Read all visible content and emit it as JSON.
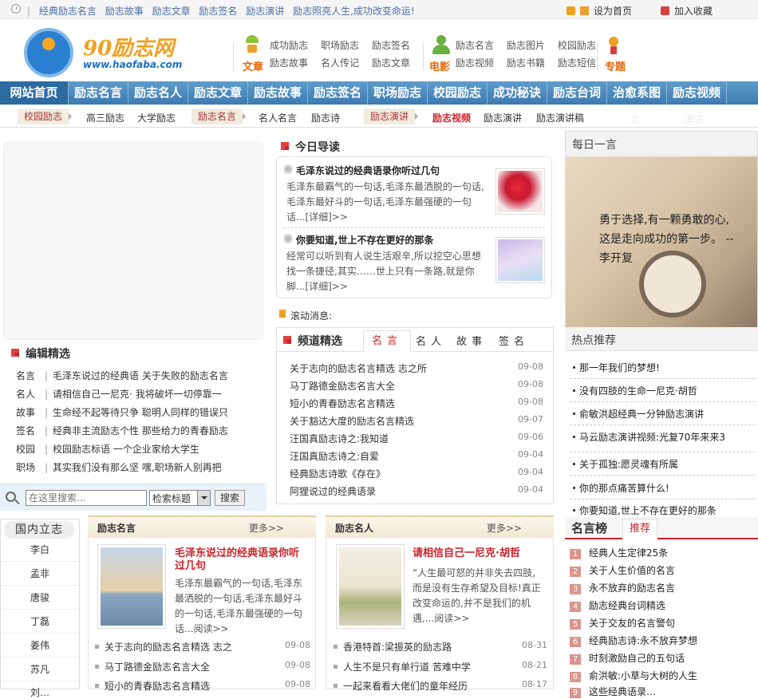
{
  "topbar": {
    "links": [
      "经典励志名言",
      "励志故事",
      "励志文章",
      "励志签名",
      "励志演讲",
      "励志照亮人生,成功改变命运!"
    ],
    "homepage": "设为首页",
    "favorite": "加入收藏"
  },
  "logo": {
    "name": "90励志网",
    "url": "www.haofaba.com"
  },
  "header_nav": {
    "group1_label": "文章",
    "group1": [
      "成功励志",
      "职场励志",
      "励志签名",
      "励志故事",
      "名人传记",
      "励志文章"
    ],
    "group2_label": "电影",
    "group2": [
      "励志名言",
      "励志图片",
      "校园励志",
      "励志视频",
      "励志书籍",
      "励志短信"
    ],
    "group3_label": "专题"
  },
  "main_nav": [
    "网站首页",
    "励志名言",
    "励志名人",
    "励志文章",
    "励志故事",
    "励志签名",
    "职场励志",
    "校园励志",
    "成功秘诀",
    "励志台词",
    "治愈系图",
    "励志视频"
  ],
  "sub_nav": {
    "tag1": "校园励志",
    "tag1_items": [
      "高三励志",
      "大学励志"
    ],
    "tag2": "励志名言",
    "tag2_items": [
      "名人名言",
      "励志诗"
    ],
    "tag3": "励志演讲",
    "tag3_items": [
      "励志视频",
      "励志演讲",
      "励志演讲稿"
    ],
    "faded": [
      "文",
      "演讲"
    ]
  },
  "editor": {
    "title": "编辑精选",
    "rows": [
      {
        "cat": "名言",
        "a": "毛泽东说过的经典语",
        "b": "关于失败的励志名言"
      },
      {
        "cat": "名人",
        "a": "请相信自己一尼克·",
        "b": "我将破坏一切停靠一"
      },
      {
        "cat": "故事",
        "a": "生命经不起等待只争",
        "b": "聪明人同样的错误只"
      },
      {
        "cat": "签名",
        "a": "经典非主流励志个性",
        "b": "那些给力的青春励志"
      },
      {
        "cat": "校园",
        "a": "校园励志标语",
        "b": "一个企业家给大学生"
      },
      {
        "cat": "职场",
        "a": "其实我们没有那么坚",
        "b": "嘿,职场新人别再把"
      }
    ]
  },
  "search": {
    "placeholder": "在这里搜索...",
    "select": "检索标题",
    "button": "搜索"
  },
  "people": {
    "title": "国内立志",
    "names": [
      "李白",
      "孟非",
      "唐骏",
      "丁磊",
      "姜伟",
      "苏凡",
      "刘…"
    ]
  },
  "today": {
    "title": "今日导读",
    "articles": [
      {
        "title": "毛泽东说过的经典语录你听过几句",
        "summary": "毛泽东最霸气的一句话,毛泽东最洒脱的一句话,毛泽东最好斗的一句话,毛泽东最强硬的一句话...[详细]>>"
      },
      {
        "title": "你要知道,世上不存在更好的那条",
        "summary": "经常可以听到有人说生活艰辛,所以挖空心思想找一条捷径,其实……世上只有一条路,就是你脚...[详细]>>"
      }
    ]
  },
  "scroll_msg": "滚动消息:",
  "channel": {
    "title": "频道精选",
    "tabs": [
      "名言",
      "名人",
      "故事",
      "签名"
    ],
    "rows": [
      {
        "t": "关于志向的励志名言精选 志之所",
        "d": "09-08"
      },
      {
        "t": "马丁路德金励志名言大全",
        "d": "09-08"
      },
      {
        "t": "短小的青春励志名言精选",
        "d": "09-08"
      },
      {
        "t": "关于豁达大度的励志名言精选",
        "d": "09-07"
      },
      {
        "t": "汪国真励志诗之:我知道",
        "d": "09-06"
      },
      {
        "t": "汪国真励志诗之:自爱",
        "d": "09-04"
      },
      {
        "t": "经典励志诗歌《存在》",
        "d": "09-04"
      },
      {
        "t": "阿狸说过的经典语录",
        "d": "09-04"
      }
    ]
  },
  "box1": {
    "title": "励志名言",
    "more": "更多>>",
    "feat_title": "毛泽东说过的经典语录你听过几句",
    "feat_sum": "毛泽东最霸气的一句话,毛泽东最洒脱的一句话,毛泽东最好斗的一句话,毛泽东最强硬的一句话...阅读>>",
    "rows": [
      {
        "t": "关于志向的励志名言精选 志之",
        "d": "09-08"
      },
      {
        "t": "马丁路德金励志名言大全",
        "d": "09-08"
      },
      {
        "t": "短小的青春励志名言精选",
        "d": "09-08"
      }
    ]
  },
  "box2": {
    "title": "励志名人",
    "more": "更多>>",
    "feat_title": "请相信自己一尼克·胡哲",
    "feat_sum": "“人生最可怒的并非失去四肢,而是没有生存希望及目标!真正改变命运的,并不是我们的机遇,...阅读>>",
    "rows": [
      {
        "t": "香港特首:梁振英的励志路",
        "d": "08-31"
      },
      {
        "t": "人生不是只有单行道 苦难中学",
        "d": "08-21"
      },
      {
        "t": "一起来看看大佬们的童年经历",
        "d": "08-17"
      }
    ]
  },
  "daily": {
    "title": "每日一言",
    "quote": "勇于选择,有一颗勇敢的心,这是走向成功的第一步。 --李开复"
  },
  "hot": {
    "title": "热点推荐",
    "rows": [
      "那一年我们的梦想!",
      "没有四肢的生命一尼克·胡哲",
      "俞敏洪超经典一分钟励志演讲",
      "马云励志演讲视频:光复70年来来3",
      "关于孤独:愿灵魂有所属",
      "你的那点痛苦算什么!",
      "你要知道,世上不存在更好的那条"
    ]
  },
  "rank": {
    "title": "名言榜",
    "tab": "推荐",
    "rows": [
      "经典人生定律25条",
      "关于人生价值的名言",
      "永不放弃的励志名言",
      "励志经典台词精选",
      "关于交友的名言警句",
      "经典励志诗:永不放弃梦想",
      "时刻激励自己的五句话",
      "俞洪敏:小草与大树的人生",
      "这些经典语录…"
    ]
  },
  "colors": {
    "nav": "#3c7ab0",
    "accent": "#c8242b",
    "orange": "#e8660a"
  }
}
